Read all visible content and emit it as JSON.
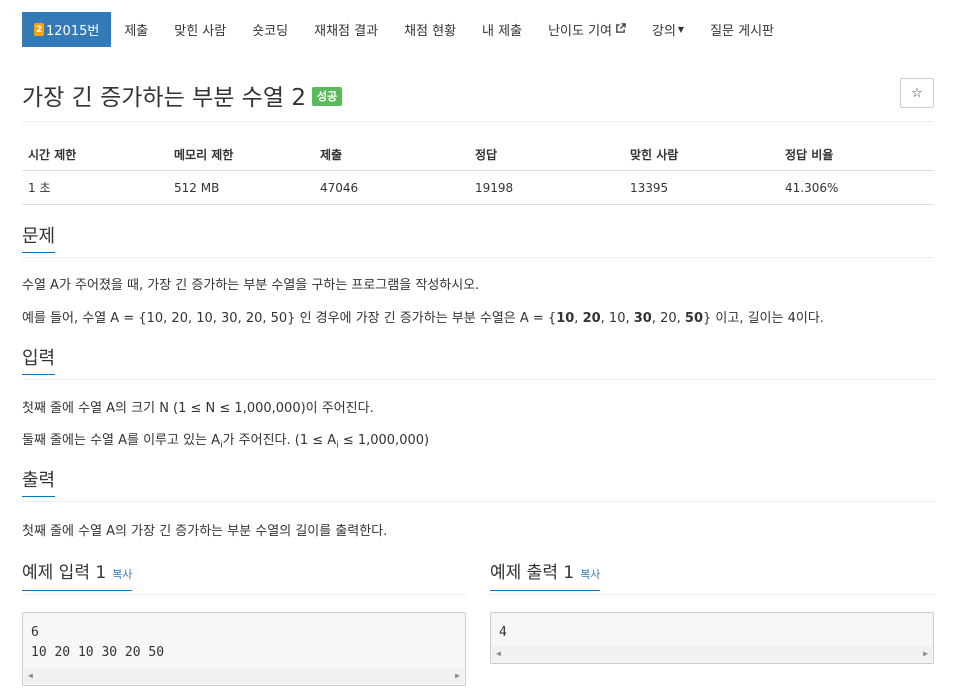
{
  "nav": {
    "problem_number": "12015번",
    "medal_icon": "2",
    "items": [
      "제출",
      "맞힌 사람",
      "숏코딩",
      "재채점 결과",
      "채점 현황",
      "내 제출",
      "난이도 기여",
      "강의",
      "질문 게시판"
    ]
  },
  "problem": {
    "title": "가장 긴 증가하는 부분 수열 2",
    "status_badge": "성공",
    "star": "☆"
  },
  "info": {
    "headers": [
      "시간 제한",
      "메모리 제한",
      "제출",
      "정답",
      "맞힌 사람",
      "정답 비율"
    ],
    "values": [
      "1 초",
      "512 MB",
      "47046",
      "19198",
      "13395",
      "41.306%"
    ]
  },
  "sections": {
    "description": {
      "heading": "문제",
      "line1": "수열 A가 주어졌을 때, 가장 긴 증가하는 부분 수열을 구하는 프로그램을 작성하시오.",
      "line2_prefix": "예를 들어, 수열 A = {10, 20, 10, 30, 20, 50} 인 경우에 가장 긴 증가하는 부분 수열은 A = {",
      "line2_seq": [
        {
          "text": "10",
          "bold": true
        },
        {
          "text": ", ",
          "bold": false
        },
        {
          "text": "20",
          "bold": true
        },
        {
          "text": ", 10, ",
          "bold": false
        },
        {
          "text": "30",
          "bold": true
        },
        {
          "text": ", 20, ",
          "bold": false
        },
        {
          "text": "50",
          "bold": true
        }
      ],
      "line2_suffix": "} 이고, 길이는 4이다."
    },
    "input": {
      "heading": "입력",
      "line1": "첫째 줄에 수열 A의 크기 N (1 ≤ N ≤ 1,000,000)이 주어진다.",
      "line2_a": "둘째 줄에는 수열 A를 이루고 있는 A",
      "line2_sub": "i",
      "line2_b": "가 주어진다. (1 ≤ A",
      "line2_sub2": "i",
      "line2_c": " ≤ 1,000,000)"
    },
    "output": {
      "heading": "출력",
      "line1": "첫째 줄에 수열 A의 가장 긴 증가하는 부분 수열의 길이를 출력한다."
    }
  },
  "samples": {
    "input_title": "예제 입력 1",
    "output_title": "예제 출력 1",
    "copy_label": "복사",
    "input_text": "6\n10 20 10 30 20 50",
    "output_text": "4"
  }
}
